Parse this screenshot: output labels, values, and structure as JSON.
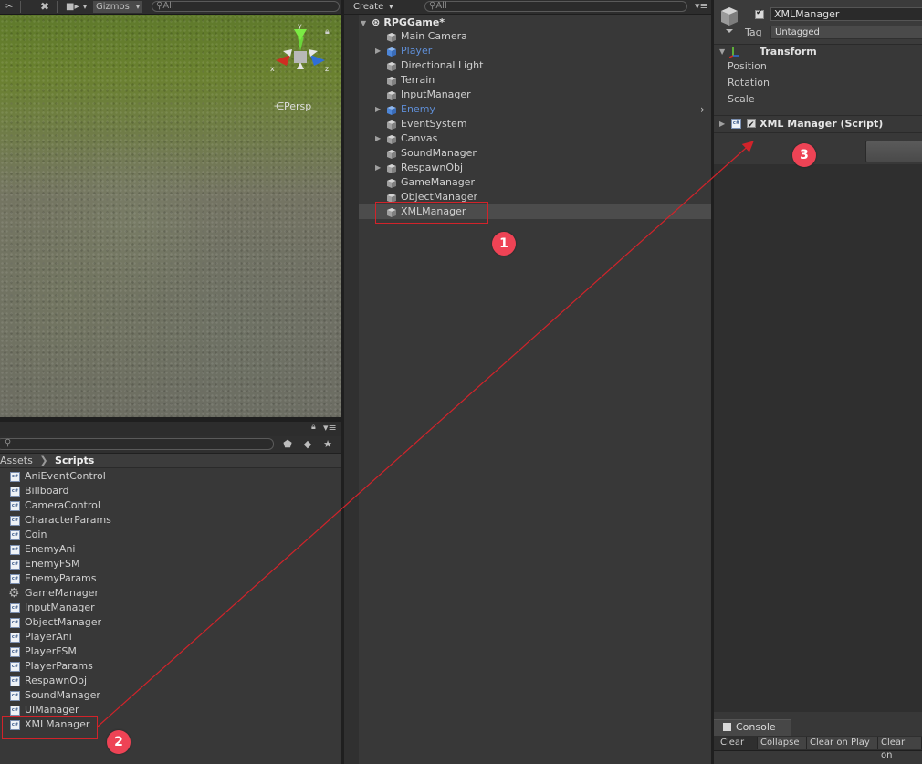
{
  "scene_toolbar": {
    "gizmos_label": "Gizmos",
    "search_placeholder": "All"
  },
  "scene_view": {
    "projection_label": "Persp",
    "axes": {
      "x": "x",
      "y": "y",
      "z": "z"
    }
  },
  "hierarchy": {
    "create_label": "Create",
    "search_placeholder": "All",
    "scene_name": "RPGGame*",
    "items": [
      {
        "label": "Main Camera",
        "expandable": false,
        "prefab": false,
        "selected": false
      },
      {
        "label": "Player",
        "expandable": true,
        "prefab": true,
        "selected": false
      },
      {
        "label": "Directional Light",
        "expandable": false,
        "prefab": false,
        "selected": false
      },
      {
        "label": "Terrain",
        "expandable": false,
        "prefab": false,
        "selected": false
      },
      {
        "label": "InputManager",
        "expandable": false,
        "prefab": false,
        "selected": false
      },
      {
        "label": "Enemy",
        "expandable": true,
        "prefab": true,
        "selected": false
      },
      {
        "label": "EventSystem",
        "expandable": false,
        "prefab": false,
        "selected": false
      },
      {
        "label": "Canvas",
        "expandable": true,
        "prefab": false,
        "selected": false
      },
      {
        "label": "SoundManager",
        "expandable": false,
        "prefab": false,
        "selected": false
      },
      {
        "label": "RespawnObj",
        "expandable": true,
        "prefab": false,
        "selected": false
      },
      {
        "label": "GameManager",
        "expandable": false,
        "prefab": false,
        "selected": false
      },
      {
        "label": "ObjectManager",
        "expandable": false,
        "prefab": false,
        "selected": false
      },
      {
        "label": "XMLManager",
        "expandable": false,
        "prefab": false,
        "selected": true
      }
    ]
  },
  "project": {
    "breadcrumb": [
      "Assets",
      "Scripts"
    ],
    "files": [
      {
        "label": "AniEventControl",
        "icon": "cs-script-icon"
      },
      {
        "label": "Billboard",
        "icon": "cs-script-icon"
      },
      {
        "label": "CameraControl",
        "icon": "cs-script-icon"
      },
      {
        "label": "CharacterParams",
        "icon": "cs-script-icon"
      },
      {
        "label": "Coin",
        "icon": "cs-script-icon"
      },
      {
        "label": "EnemyAni",
        "icon": "cs-script-icon"
      },
      {
        "label": "EnemyFSM",
        "icon": "cs-script-icon"
      },
      {
        "label": "EnemyParams",
        "icon": "cs-script-icon"
      },
      {
        "label": "GameManager",
        "icon": "gear-icon"
      },
      {
        "label": "InputManager",
        "icon": "cs-script-icon"
      },
      {
        "label": "ObjectManager",
        "icon": "cs-script-icon"
      },
      {
        "label": "PlayerAni",
        "icon": "cs-script-icon"
      },
      {
        "label": "PlayerFSM",
        "icon": "cs-script-icon"
      },
      {
        "label": "PlayerParams",
        "icon": "cs-script-icon"
      },
      {
        "label": "RespawnObj",
        "icon": "cs-script-icon"
      },
      {
        "label": "SoundManager",
        "icon": "cs-script-icon"
      },
      {
        "label": "UIManager",
        "icon": "cs-script-icon"
      },
      {
        "label": "XMLManager",
        "icon": "cs-script-icon"
      }
    ]
  },
  "inspector": {
    "object_name": "XMLManager",
    "tag_label": "Tag",
    "tag_value": "Untagged",
    "transform": {
      "title": "Transform",
      "fields": [
        "Position",
        "Rotation",
        "Scale"
      ]
    },
    "script_component_title": "XML Manager (Script)"
  },
  "console": {
    "tab_label": "Console",
    "buttons": [
      "Clear",
      "Collapse",
      "Clear on Play",
      "Clear on"
    ]
  },
  "annotations": {
    "step1": "1",
    "step2": "2",
    "step3": "3",
    "color": "#ee4355"
  },
  "icons": {
    "code": "cs",
    "cs_script": "c#"
  }
}
